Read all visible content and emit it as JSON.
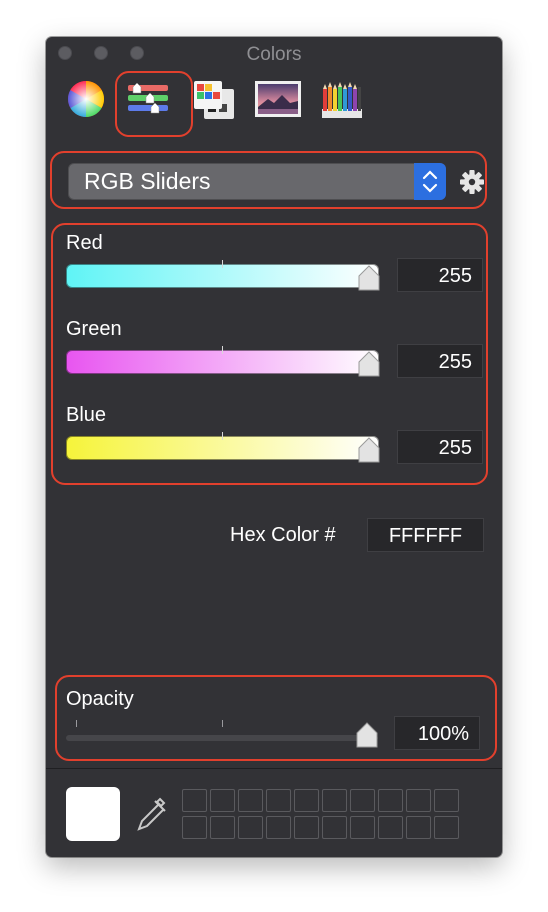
{
  "window": {
    "title": "Colors"
  },
  "toolbar": {
    "tools": [
      {
        "name": "color-wheel"
      },
      {
        "name": "color-sliders",
        "selected": true
      },
      {
        "name": "color-palettes"
      },
      {
        "name": "image-palettes"
      },
      {
        "name": "pencils"
      }
    ]
  },
  "mode_select": {
    "value": "RGB Sliders"
  },
  "sliders": [
    {
      "label": "Red",
      "value": "255",
      "fraction": 1.0,
      "gradient_start": "#5ff4f6",
      "gradient_end": "#ffffff"
    },
    {
      "label": "Green",
      "value": "255",
      "fraction": 1.0,
      "gradient_start": "#e855f0",
      "gradient_end": "#ffffff"
    },
    {
      "label": "Blue",
      "value": "255",
      "fraction": 1.0,
      "gradient_start": "#f6f43a",
      "gradient_end": "#ffffff"
    }
  ],
  "hex": {
    "label": "Hex Color #",
    "value": "FFFFFF"
  },
  "opacity": {
    "label": "Opacity",
    "value": "100%",
    "fraction": 1.0
  },
  "current_color": "#FFFFFF",
  "annotation_color": "#e2402d",
  "accent_color": "#2c6fe0"
}
